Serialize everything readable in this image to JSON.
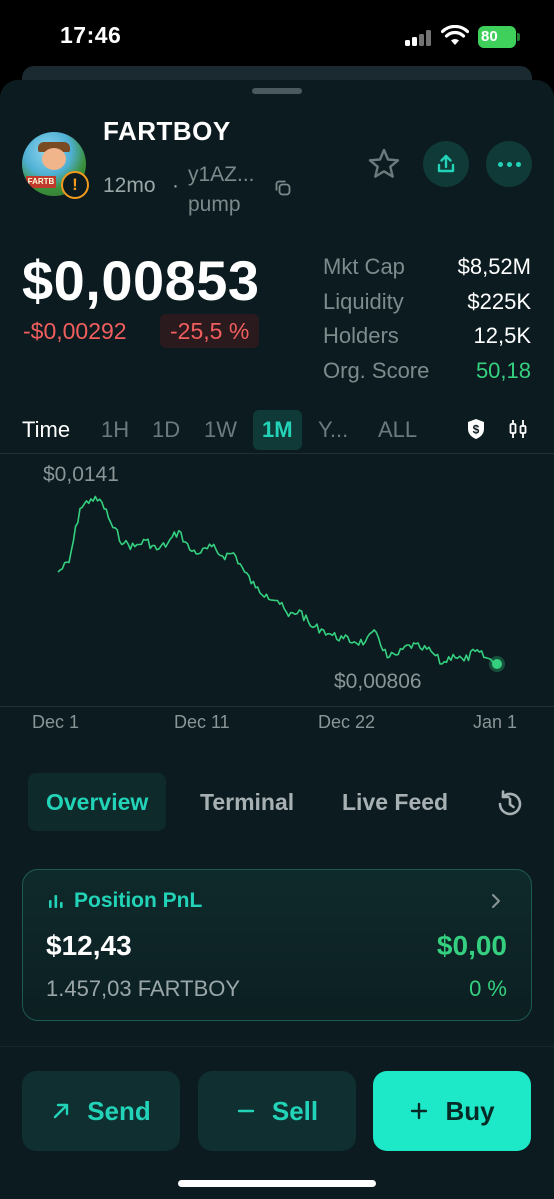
{
  "status_bar": {
    "time": "17:46",
    "battery": "80"
  },
  "token": {
    "name": "FARTBOY",
    "age": "12mo",
    "separator": "·",
    "address": "y1AZ...",
    "platform": "pump",
    "warning_symbol": "!"
  },
  "price": {
    "current": "$0,00853",
    "change_abs": "-$0,00292",
    "change_pct": "-25,5 %"
  },
  "stats": [
    {
      "label": "Mkt Cap",
      "value": "$8,52M"
    },
    {
      "label": "Liquidity",
      "value": "$225K"
    },
    {
      "label": "Holders",
      "value": "12,5K"
    },
    {
      "label": "Org. Score",
      "value": "50,18"
    }
  ],
  "timeframes": {
    "label": "Time",
    "options": [
      "1H",
      "1D",
      "1W",
      "1M",
      "Y...",
      "ALL"
    ],
    "active": "1M"
  },
  "chart_data": {
    "type": "line",
    "x_ticks": [
      "Dec 1",
      "Dec 11",
      "Dec 22",
      "Jan 1"
    ],
    "high_label": "$0,0141",
    "low_label": "$0,00806",
    "series": [
      {
        "values": [
          0.0118,
          0.0121,
          0.0138,
          0.0141,
          0.014,
          0.0132,
          0.0127,
          0.0126,
          0.0128,
          0.0125,
          0.0127,
          0.0131,
          0.0125,
          0.0124,
          0.0126,
          0.0123,
          0.0124,
          0.0118,
          0.0113,
          0.0111,
          0.0109,
          0.0104,
          0.0106,
          0.0101,
          0.01,
          0.0098,
          0.0097,
          0.0096,
          0.0096,
          0.0099,
          0.0091,
          0.0092,
          0.0095,
          0.0094,
          0.0093,
          0.0089,
          0.0092,
          0.009,
          0.0093,
          0.0091,
          0.0089
        ]
      }
    ],
    "colors": {
      "line": "#35d07f"
    }
  },
  "tabs": {
    "items": [
      "Overview",
      "Terminal",
      "Live Feed"
    ],
    "active": "Overview"
  },
  "position": {
    "title": "Position PnL",
    "value": "$12,43",
    "pnl": "$0,00",
    "quantity": "1.457,03 FARTBOY",
    "pnl_pct": "0 %"
  },
  "actions": {
    "send": "Send",
    "sell": "Sell",
    "buy": "Buy"
  },
  "colors": {
    "accent": "#22d3b8",
    "positive": "#35d07f",
    "negative": "#f25e5e",
    "background": "#0b1b1f",
    "warning": "#f29a1e"
  }
}
